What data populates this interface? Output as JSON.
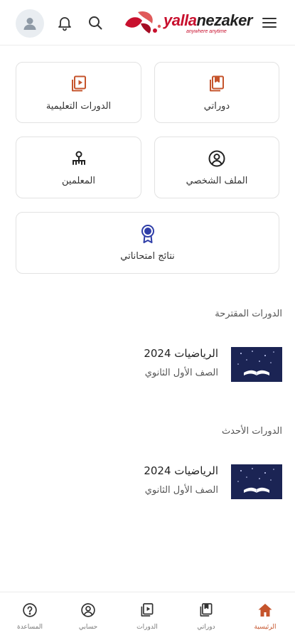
{
  "header": {
    "logo_brand_red": "yalla",
    "logo_brand_dark": "nezaker",
    "logo_tagline": "anywhere anytime"
  },
  "tiles": [
    {
      "label": "دوراتي",
      "icon": "my-courses-icon"
    },
    {
      "label": "الدورات التعليمية",
      "icon": "play-courses-icon"
    },
    {
      "label": "الملف الشخصي",
      "icon": "profile-icon"
    },
    {
      "label": "المعلمين",
      "icon": "teachers-icon"
    },
    {
      "label": "نتائج امتحاناتي",
      "icon": "award-icon"
    }
  ],
  "sections": [
    {
      "title": "الدورات المقترحة",
      "courses": [
        {
          "title": "الرياضيات 2024",
          "subtitle": "الصف الأول الثانوي"
        }
      ]
    },
    {
      "title": "الدورات الأحدث",
      "courses": [
        {
          "title": "الرياضيات 2024",
          "subtitle": "الصف الأول الثانوي"
        }
      ]
    }
  ],
  "bottom_nav": [
    {
      "label": "الرئيسية",
      "icon": "home-icon",
      "active": true
    },
    {
      "label": "دوراتي",
      "icon": "my-courses-icon"
    },
    {
      "label": "الدورات",
      "icon": "play-courses-icon"
    },
    {
      "label": "حسابي",
      "icon": "account-icon"
    },
    {
      "label": "المساعدة",
      "icon": "help-icon"
    }
  ],
  "colors": {
    "accent": "#c5542c",
    "brand_red": "#c8102e",
    "award": "#2f3ea8",
    "thumb_bg": "#1b2454"
  }
}
